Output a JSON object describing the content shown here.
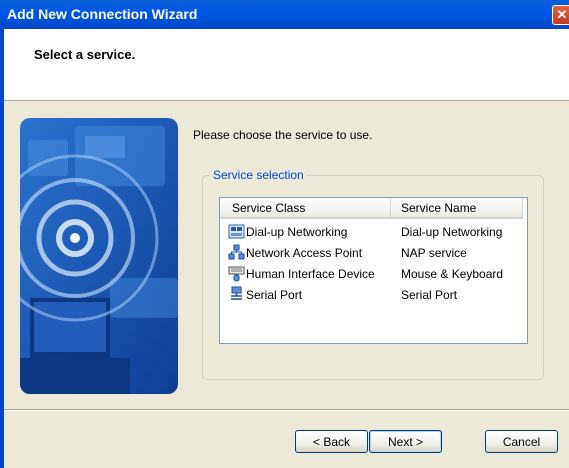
{
  "window": {
    "title": "Add New Connection Wizard",
    "close_glyph": "✕"
  },
  "header": {
    "title": "Select a service."
  },
  "main": {
    "prompt": "Please choose the service to use.",
    "group_label": "Service selection",
    "columns": [
      "Service Class",
      "Service Name"
    ],
    "services": [
      {
        "class": "Dial-up Networking",
        "name": "Dial-up Networking",
        "icon": "dialup-networking-icon"
      },
      {
        "class": "Network Access Point",
        "name": "NAP service",
        "icon": "network-access-point-icon"
      },
      {
        "class": "Human Interface Device",
        "name": "Mouse & Keyboard",
        "icon": "keyboard-mouse-icon"
      },
      {
        "class": "Serial Port",
        "name": "Serial Port",
        "icon": "serial-port-icon"
      }
    ]
  },
  "buttons": {
    "back": "< Back",
    "next": "Next >",
    "cancel": "Cancel"
  },
  "colors": {
    "titlebar": "#0058E6",
    "window_bg": "#ECE9D8",
    "illustration": "#1B5FB8",
    "group_label": "#0046D5"
  }
}
